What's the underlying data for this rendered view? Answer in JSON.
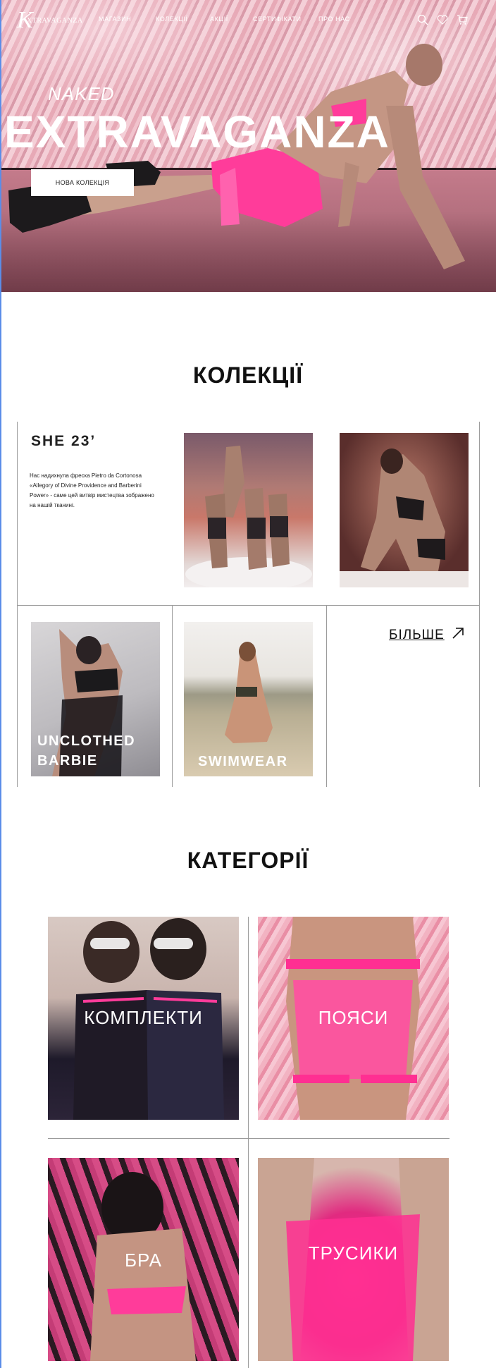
{
  "header": {
    "logo_letter": "K",
    "logo_text": "XTRAVAGANZA",
    "nav": [
      "МАГАЗИН",
      "КОЛЕКЦІЇ",
      "АКЦІЇ",
      "СЕРТИФІКАТИ",
      "ПРО НАС"
    ],
    "icons": [
      "search-icon",
      "heart-icon",
      "cart-icon"
    ]
  },
  "hero": {
    "subtitle": "NAKED",
    "title": "EXTRAVAGANZA",
    "button_label": "НОВА КОЛЕКЦІЯ"
  },
  "collections": {
    "title": "КОЛЕКЦІЇ",
    "featured": {
      "name": "SHE 23’",
      "description": "Нас надихнула фреска Pietro da Cortonosa «Allegory of Divine Providence and Barberini Power» - саме цей витвір мистецтва зображено на нашій тканині."
    },
    "items": [
      "UNCLOTHED BARBIE",
      "SWIMWEAR"
    ],
    "more_label": "БІЛЬШЕ"
  },
  "categories": {
    "title": "КАТЕГОРІЇ",
    "items": [
      "КОМПЛЕКТИ",
      "ПОЯСИ",
      "БРА",
      "ТРУСИКИ"
    ]
  },
  "colors": {
    "accent_pink": "#ff2f92",
    "divider": "#9b9b9b",
    "left_accent": "#5b8de8"
  }
}
